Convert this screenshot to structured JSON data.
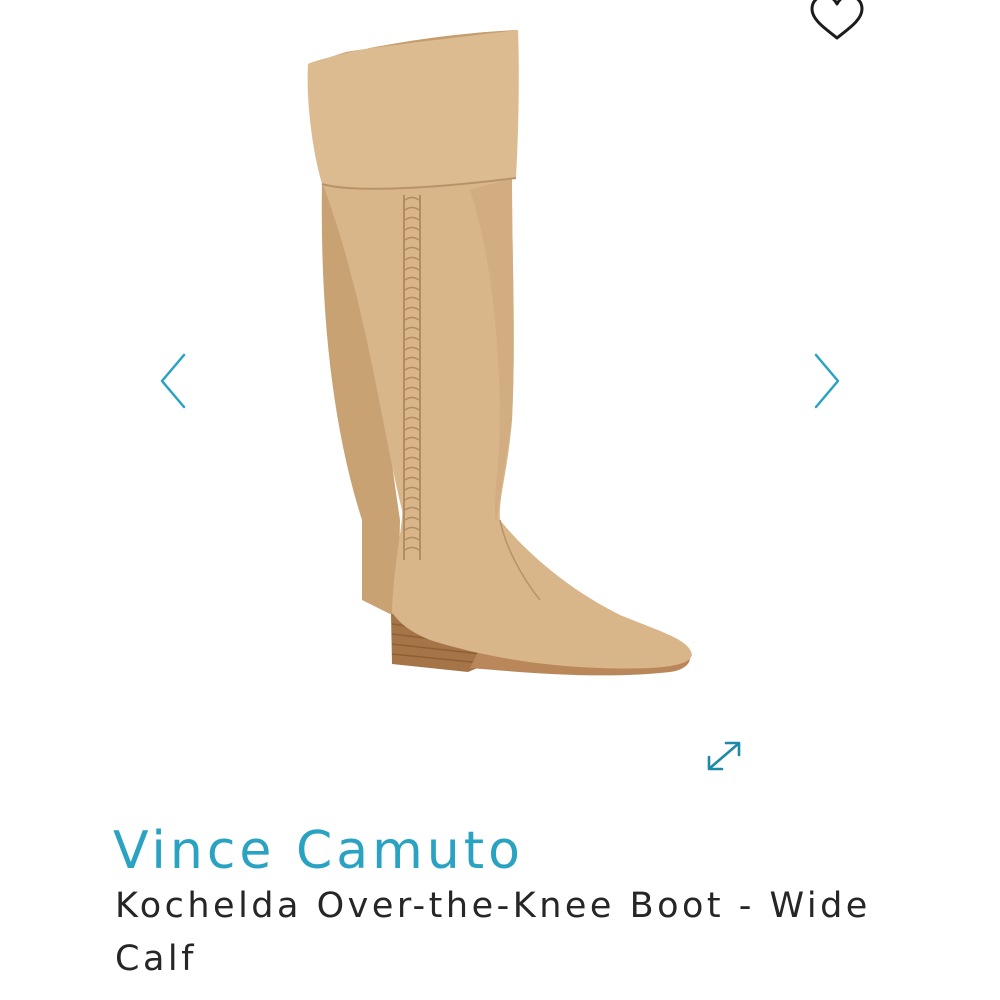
{
  "product": {
    "brand": "Vince Camuto",
    "title": "Kochelda Over-the-Knee Boot - Wide Calf",
    "image": "tan-suede-over-the-knee-boot"
  },
  "icons": {
    "wishlist": "heart-outline-icon",
    "previous": "chevron-left-icon",
    "next": "chevron-right-icon",
    "expand": "expand-arrows-icon"
  },
  "colors": {
    "accent": "#2aa3c2",
    "title_text": "#262626",
    "suede": "#d9b58a",
    "heel_wood": "#a57447",
    "background": "#ffffff"
  }
}
